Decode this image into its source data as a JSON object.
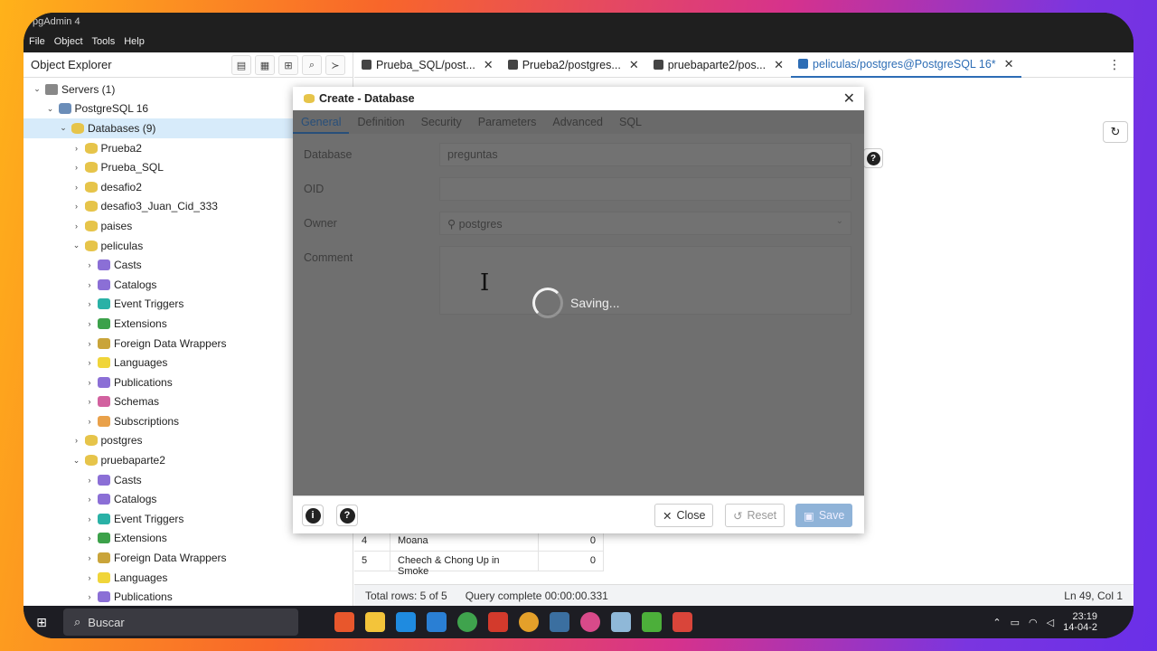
{
  "window": {
    "title": "pgAdmin 4"
  },
  "menu": [
    "File",
    "Object",
    "Tools",
    "Help"
  ],
  "explorer": {
    "title": "Object Explorer",
    "tree": [
      {
        "label": "Servers (1)",
        "level": 0,
        "icon": "servers-icon",
        "chev": "v"
      },
      {
        "label": "PostgreSQL 16",
        "level": 1,
        "icon": "server-icon",
        "chev": "v"
      },
      {
        "label": "Databases (9)",
        "level": 2,
        "icon": "database-icon",
        "chev": "v",
        "selected": true
      },
      {
        "label": "Prueba2",
        "level": 3,
        "icon": "database-icon",
        "chev": ">"
      },
      {
        "label": "Prueba_SQL",
        "level": 3,
        "icon": "database-icon",
        "chev": ">"
      },
      {
        "label": "desafio2",
        "level": 3,
        "icon": "database-icon",
        "chev": ">"
      },
      {
        "label": "desafio3_Juan_Cid_333",
        "level": 3,
        "icon": "database-icon",
        "chev": ">"
      },
      {
        "label": "paises",
        "level": 3,
        "icon": "database-icon",
        "chev": ">"
      },
      {
        "label": "peliculas",
        "level": 3,
        "icon": "database-icon",
        "chev": "v"
      },
      {
        "label": "Casts",
        "level": 4,
        "icon": "casts-icon",
        "chev": ">"
      },
      {
        "label": "Catalogs",
        "level": 4,
        "icon": "catalogs-icon",
        "chev": ">"
      },
      {
        "label": "Event Triggers",
        "level": 4,
        "icon": "event-triggers-icon",
        "chev": ">"
      },
      {
        "label": "Extensions",
        "level": 4,
        "icon": "extensions-icon",
        "chev": ">"
      },
      {
        "label": "Foreign Data Wrappers",
        "level": 4,
        "icon": "fdw-icon",
        "chev": ">"
      },
      {
        "label": "Languages",
        "level": 4,
        "icon": "languages-icon",
        "chev": ">"
      },
      {
        "label": "Publications",
        "level": 4,
        "icon": "publications-icon",
        "chev": ">"
      },
      {
        "label": "Schemas",
        "level": 4,
        "icon": "schemas-icon",
        "chev": ">"
      },
      {
        "label": "Subscriptions",
        "level": 4,
        "icon": "subscriptions-icon",
        "chev": ">"
      },
      {
        "label": "postgres",
        "level": 3,
        "icon": "database-icon",
        "chev": ">"
      },
      {
        "label": "pruebaparte2",
        "level": 3,
        "icon": "database-icon",
        "chev": "v"
      },
      {
        "label": "Casts",
        "level": 4,
        "icon": "casts-icon",
        "chev": ">"
      },
      {
        "label": "Catalogs",
        "level": 4,
        "icon": "catalogs-icon",
        "chev": ">"
      },
      {
        "label": "Event Triggers",
        "level": 4,
        "icon": "event-triggers-icon",
        "chev": ">"
      },
      {
        "label": "Extensions",
        "level": 4,
        "icon": "extensions-icon",
        "chev": ">"
      },
      {
        "label": "Foreign Data Wrappers",
        "level": 4,
        "icon": "fdw-icon",
        "chev": ">"
      },
      {
        "label": "Languages",
        "level": 4,
        "icon": "languages-icon",
        "chev": ">"
      },
      {
        "label": "Publications",
        "level": 4,
        "icon": "publications-icon",
        "chev": ">"
      }
    ]
  },
  "tabs": [
    {
      "label": "Prueba_SQL/post...",
      "active": false
    },
    {
      "label": "Prueba2/postgres...",
      "active": false
    },
    {
      "label": "pruebaparte2/pos...",
      "active": false
    },
    {
      "label": "peliculas/postgres@PostgreSQL 16*",
      "active": true
    }
  ],
  "results": {
    "rows": [
      {
        "n": "4",
        "name": "Moana",
        "val": "0"
      },
      {
        "n": "5",
        "name": "Cheech & Chong Up in Smoke",
        "val": "0"
      }
    ]
  },
  "status": {
    "total_rows": "Total rows: 5 of 5",
    "query": "Query complete 00:00:00.331",
    "position": "Ln 49, Col 1"
  },
  "dialog": {
    "title": "Create - Database",
    "tabs": [
      "General",
      "Definition",
      "Security",
      "Parameters",
      "Advanced",
      "SQL"
    ],
    "fields": {
      "database_label": "Database",
      "database_value": "preguntas",
      "oid_label": "OID",
      "owner_label": "Owner",
      "owner_value": "postgres",
      "comment_label": "Comment"
    },
    "saving_text": "Saving...",
    "buttons": {
      "close": "Close",
      "reset": "Reset",
      "save": "Save"
    }
  },
  "taskbar": {
    "search_placeholder": "Buscar",
    "time": "23:19",
    "date": "14-04-2"
  },
  "colors": {
    "accent": "#2d6db5",
    "selection": "#d7ebfa",
    "save": "#8fb3d8"
  }
}
